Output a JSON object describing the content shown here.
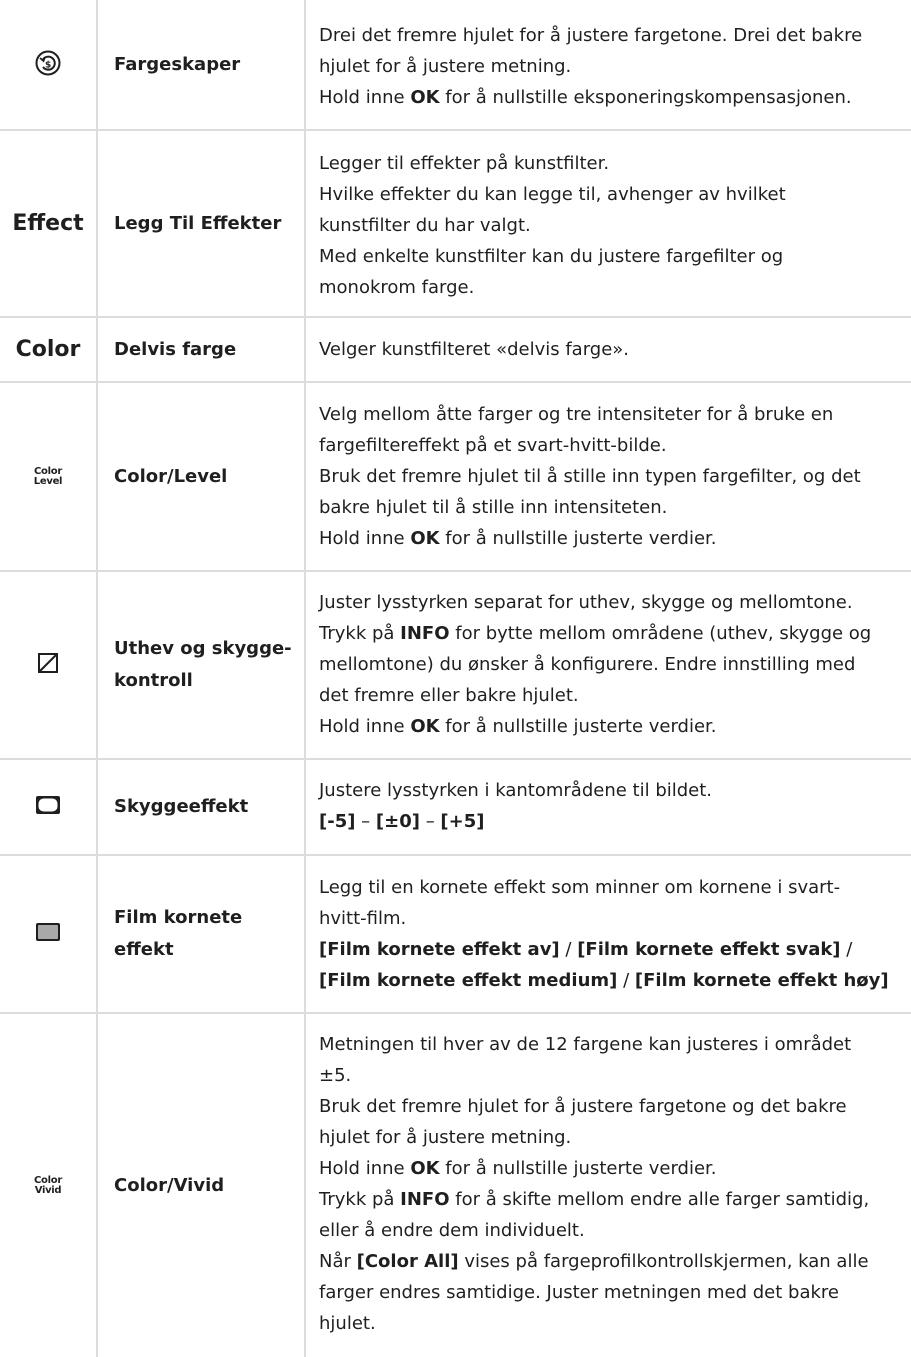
{
  "rows": [
    {
      "name": "Fargeskaper",
      "icon": "color-creator-dial-icon",
      "lines": [
        "Drei det fremre hjulet for å justere fargetone. Drei det bakre",
        "hjulet for å justere metning."
      ],
      "ok_pre": "Hold inne ",
      "ok_key": "OK",
      "ok_post": " for å nullstille eksponeringskompensasjonen."
    },
    {
      "name": "Legg Til Effekter",
      "icon_text": "Effect",
      "lines": [
        "Legger til effekter på kunstfilter.",
        "Hvilke effekter du kan legge til, avhenger av hvilket",
        "kunstfilter du har valgt.",
        "Med enkelte kunstfilter kan du justere fargefilter og",
        "monokrom farge."
      ]
    },
    {
      "name": "Delvis farge",
      "icon_text": "Color",
      "lines": [
        "Velger kunstfilteret «delvis farge»."
      ]
    },
    {
      "name": "Color/Level",
      "icon_top": "Color",
      "icon_bottom": "Level",
      "lines": [
        "Velg mellom åtte farger og tre intensiteter for å bruke en",
        "fargefiltereffekt på et svart-hvitt-bilde.",
        "Bruk det fremre hjulet til å stille inn typen fargefilter, og det",
        "bakre hjulet til å stille inn intensiteten."
      ],
      "ok_pre": "Hold inne ",
      "ok_key": "OK",
      "ok_post": " for å nullstille justerte verdier."
    },
    {
      "name_l1": "Uthev og skygge-",
      "name_l2": "kontroll",
      "icon": "highlight-shadow-icon",
      "l1": "Juster lysstyrken separat for uthev, skygge og mellomtone.",
      "info_pre": "Trykk på ",
      "info_key": "INFO",
      "info_post": " for bytte mellom områdene (uthev, skygge og",
      "l3": "mellomtone) du ønsker å konfigurere. Endre innstilling med",
      "l4": "det fremre eller bakre hjulet.",
      "ok_pre": "Hold inne ",
      "ok_key": "OK",
      "ok_post": " for å nullstille justerte verdier."
    },
    {
      "name": "Skyggeeffekt",
      "icon": "vignette-icon",
      "l1": "Justere lysstyrken i kantområdene til bildet.",
      "opt1": "[-5]",
      "sep1": " – ",
      "opt2": "[±0]",
      "sep2": " – ",
      "opt3": "[+5]"
    },
    {
      "name_l1": "Film kornete",
      "name_l2": "effekt",
      "icon": "film-grain-icon",
      "l1": "Legg til en kornete effekt som minner om kornene i svart-",
      "l2": "hvitt-film.",
      "o1": "[Film kornete effekt av]",
      "s1": " / ",
      "o2": "[Film kornete effekt svak]",
      "s2": " /",
      "o3": "[Film kornete effekt medium]",
      "s3": " / ",
      "o4": "[Film kornete effekt høy]"
    },
    {
      "name": "Color/Vivid",
      "icon_top": "Color",
      "icon_bottom": "Vivid",
      "l1": "Metningen til hver av de 12 fargene kan justeres i området",
      "l2": "±5.",
      "l3": "Bruk det fremre hjulet for å justere fargetone og det bakre",
      "l4": "hjulet for å justere metning.",
      "ok_pre": "Hold inne ",
      "ok_key": "OK",
      "ok_post": " for å nullstille justerte verdier.",
      "info_pre": "Trykk på ",
      "info_key": "INFO",
      "info_post": " for å skifte mellom endre alle farger samtidig,",
      "l7": "eller å endre dem individuelt.",
      "ca_pre": "Når ",
      "ca_key": "[Color All]",
      "ca_post": " vises på fargeprofilkontrollskjermen, kan alle",
      "l9": "farger endres samtidige. Juster metningen med det bakre",
      "l10": "hjulet."
    }
  ]
}
